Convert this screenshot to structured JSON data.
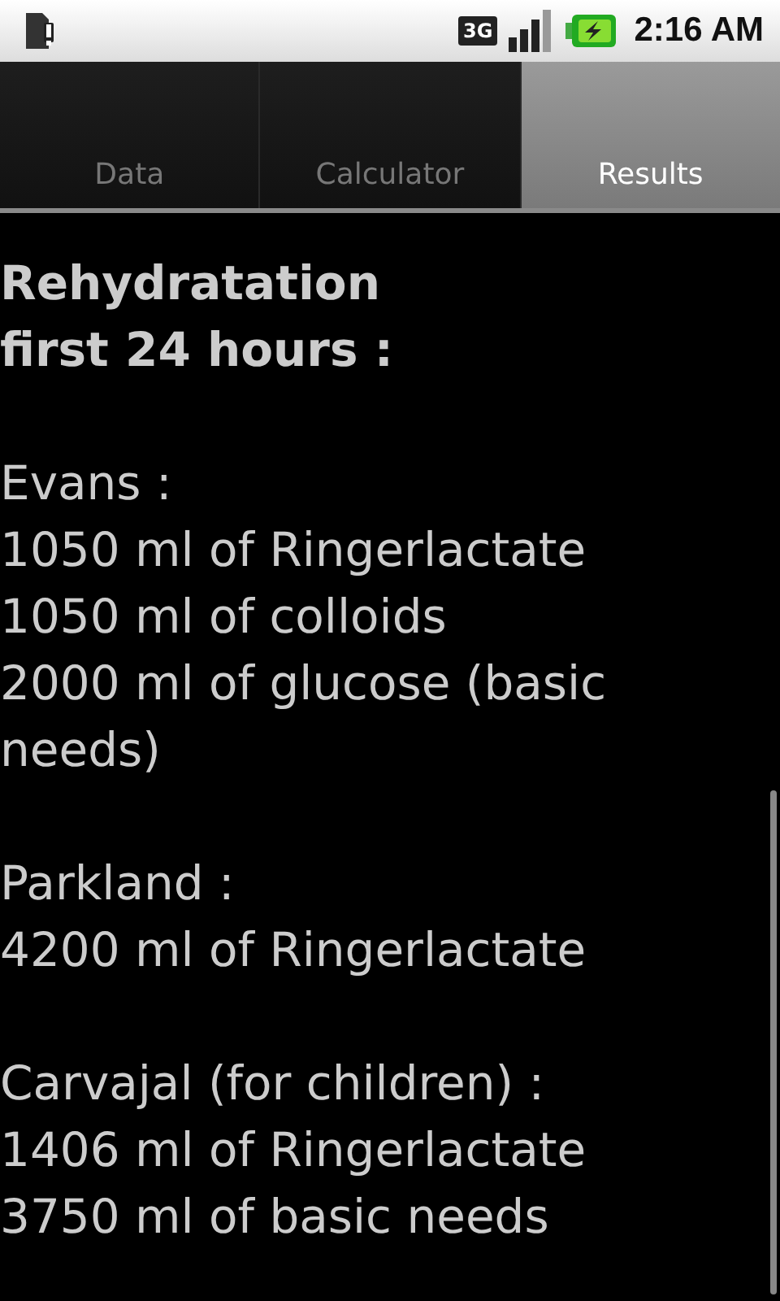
{
  "status_bar": {
    "network": "3G",
    "time": "2:16 AM"
  },
  "tabs": [
    {
      "label": "Data",
      "selected": false
    },
    {
      "label": "Calculator",
      "selected": false
    },
    {
      "label": "Results",
      "selected": true
    }
  ],
  "results": {
    "heading": [
      "Rehydratation",
      "first 24 hours :"
    ],
    "sections": [
      {
        "title": "Evans :",
        "lines": [
          "1050 ml of Ringerlactate",
          "1050 ml of colloids",
          "2000 ml of glucose (basic needs)"
        ]
      },
      {
        "title": "Parkland :",
        "lines": [
          "4200 ml of Ringerlactate"
        ]
      },
      {
        "title": "Carvajal (for children) :",
        "lines": [
          "1406 ml of Ringerlactate",
          "3750 ml of basic needs"
        ]
      }
    ]
  }
}
